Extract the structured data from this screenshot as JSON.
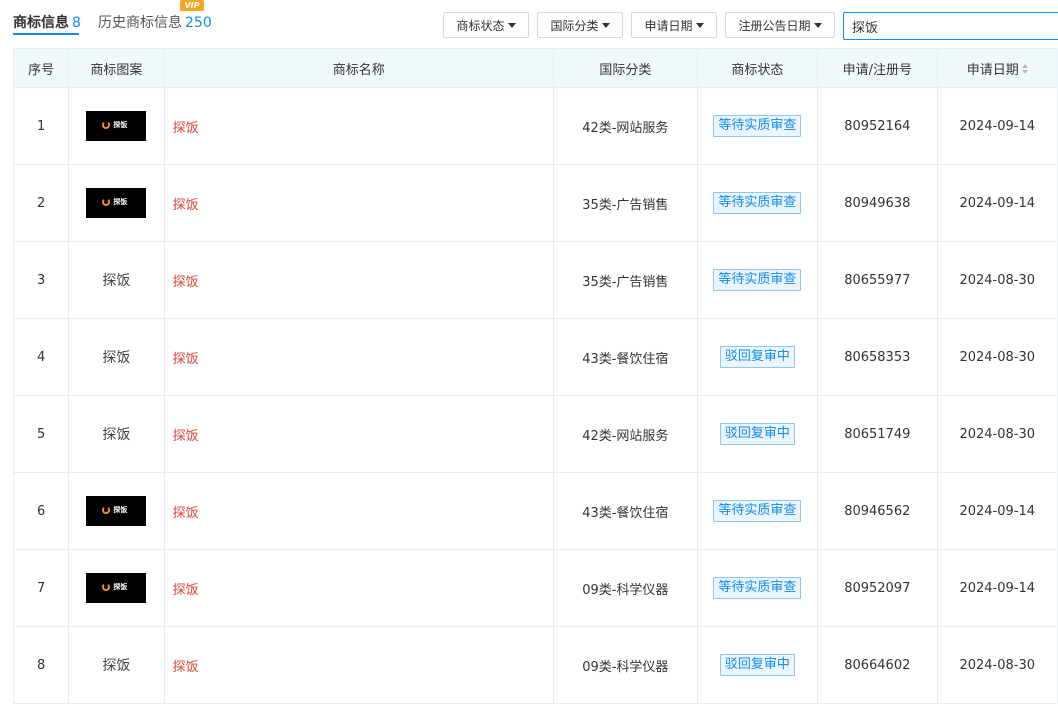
{
  "tabs": {
    "active": {
      "label": "商标信息",
      "count": "8"
    },
    "history": {
      "label": "历史商标信息",
      "count": "250",
      "vip": "VIP"
    }
  },
  "filters": [
    {
      "label": "商标状态"
    },
    {
      "label": "国际分类"
    },
    {
      "label": "申请日期"
    },
    {
      "label": "注册公告日期"
    }
  ],
  "search": {
    "value": "探饭"
  },
  "table": {
    "headers": {
      "index": "序号",
      "image": "商标图案",
      "name": "商标名称",
      "class": "国际分类",
      "status": "商标状态",
      "reg_no": "申请/注册号",
      "date": "申请日期"
    },
    "rows": [
      {
        "index": "1",
        "image_type": "logo",
        "image_text": "探饭",
        "name": "探饭",
        "class": "42类-网站服务",
        "status": "等待实质审查",
        "reg_no": "80952164",
        "date": "2024-09-14"
      },
      {
        "index": "2",
        "image_type": "logo",
        "image_text": "探饭",
        "name": "探饭",
        "class": "35类-广告销售",
        "status": "等待实质审查",
        "reg_no": "80949638",
        "date": "2024-09-14"
      },
      {
        "index": "3",
        "image_type": "text",
        "image_text": "探饭",
        "name": "探饭",
        "class": "35类-广告销售",
        "status": "等待实质审查",
        "reg_no": "80655977",
        "date": "2024-08-30"
      },
      {
        "index": "4",
        "image_type": "text",
        "image_text": "探饭",
        "name": "探饭",
        "class": "43类-餐饮住宿",
        "status": "驳回复审中",
        "reg_no": "80658353",
        "date": "2024-08-30"
      },
      {
        "index": "5",
        "image_type": "text",
        "image_text": "探饭",
        "name": "探饭",
        "class": "42类-网站服务",
        "status": "驳回复审中",
        "reg_no": "80651749",
        "date": "2024-08-30"
      },
      {
        "index": "6",
        "image_type": "logo",
        "image_text": "探饭",
        "name": "探饭",
        "class": "43类-餐饮住宿",
        "status": "等待实质审查",
        "reg_no": "80946562",
        "date": "2024-09-14"
      },
      {
        "index": "7",
        "image_type": "logo",
        "image_text": "探饭",
        "name": "探饭",
        "class": "09类-科学仪器",
        "status": "等待实质审查",
        "reg_no": "80952097",
        "date": "2024-09-14"
      },
      {
        "index": "8",
        "image_type": "text",
        "image_text": "探饭",
        "name": "探饭",
        "class": "09类-科学仪器",
        "status": "驳回复审中",
        "reg_no": "80664602",
        "date": "2024-08-30"
      }
    ]
  },
  "colors": {
    "accent": "#128bed",
    "name_red": "#e0463a",
    "header_bg": "#f2f9fc",
    "vip": "#f5a623"
  },
  "icons": {
    "filter_caret": "caret-down-icon",
    "sort": "sort-icon",
    "logo_swirl": "swirl-icon"
  }
}
